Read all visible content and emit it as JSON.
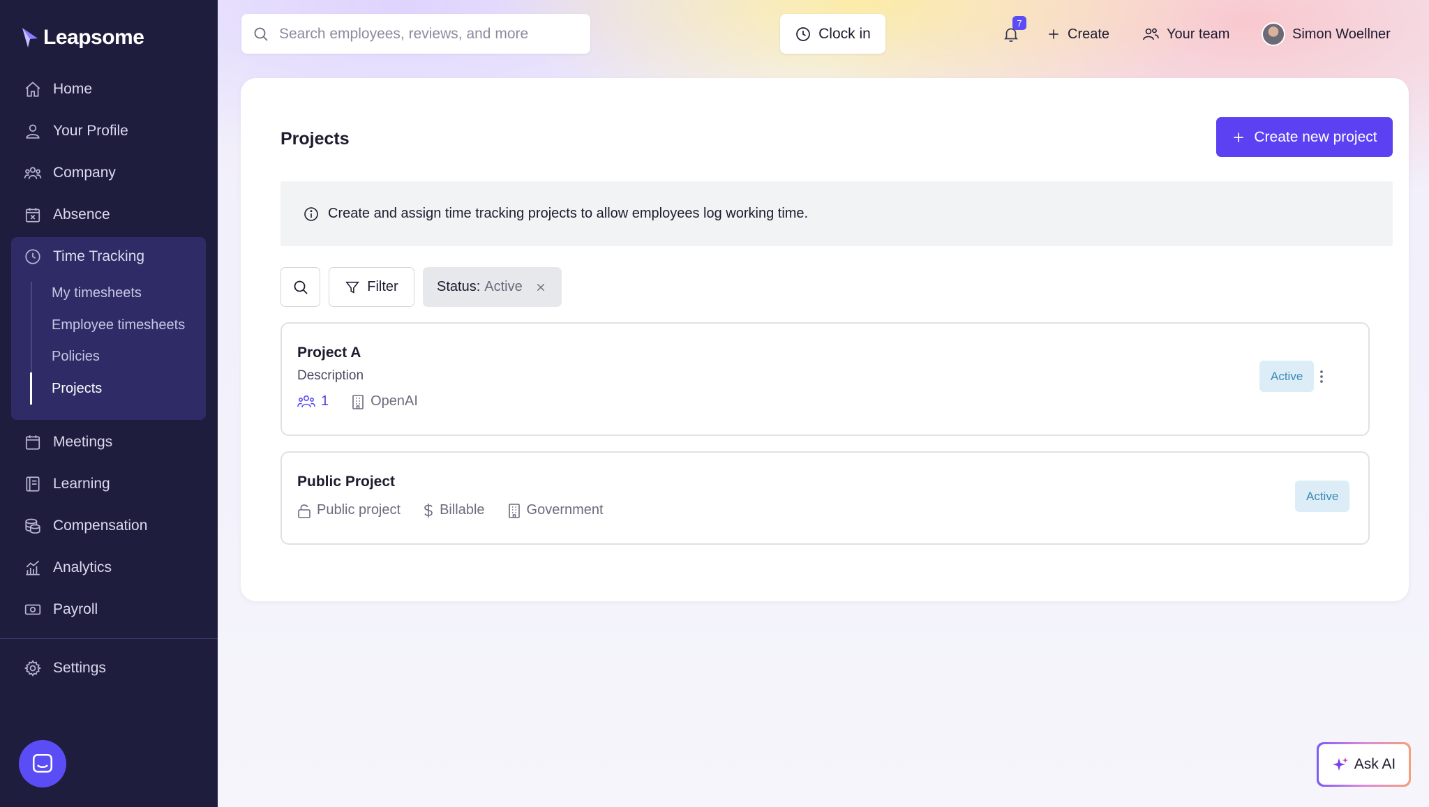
{
  "app": {
    "name": "Leapsome"
  },
  "sidebar": {
    "items": [
      {
        "label": "Home",
        "icon": "home-icon"
      },
      {
        "label": "Your Profile",
        "icon": "user-icon"
      },
      {
        "label": "Company",
        "icon": "company-icon"
      },
      {
        "label": "Absence",
        "icon": "calendar-x-icon"
      },
      {
        "label": "Time Tracking",
        "icon": "clock-icon"
      },
      {
        "label": "Meetings",
        "icon": "calendar-icon"
      },
      {
        "label": "Learning",
        "icon": "book-icon"
      },
      {
        "label": "Compensation",
        "icon": "coins-icon"
      },
      {
        "label": "Analytics",
        "icon": "analytics-icon"
      },
      {
        "label": "Payroll",
        "icon": "banknote-icon"
      }
    ],
    "time_tracking_sub": [
      {
        "label": "My timesheets"
      },
      {
        "label": "Employee timesheets"
      },
      {
        "label": "Policies"
      },
      {
        "label": "Projects",
        "active": true
      }
    ],
    "settings_label": "Settings"
  },
  "topbar": {
    "search_placeholder": "Search employees, reviews, and more",
    "clock_in_label": "Clock in",
    "notification_count": "7",
    "create_label": "Create",
    "your_team_label": "Your team",
    "user_name": "Simon Woellner"
  },
  "page": {
    "title": "Projects",
    "create_button_label": "Create new project",
    "info_text": "Create and assign time tracking projects to allow employees log working time.",
    "filter_label": "Filter",
    "status_filter_key": "Status:",
    "status_filter_value": "Active"
  },
  "projects": [
    {
      "name": "Project A",
      "description": "Description",
      "member_count": "1",
      "client": "OpenAI",
      "status": "Active"
    },
    {
      "name": "Public Project",
      "visibility": "Public project",
      "billing": "Billable",
      "client": "Government",
      "status": "Active"
    }
  ],
  "ask_ai_label": "Ask AI",
  "colors": {
    "sidebar_bg": "#1f1d3d",
    "sidebar_active_bg": "#2e2b66",
    "accent": "#5b41f2",
    "status_pill_bg": "#dcedf7",
    "status_pill_text": "#3b88b5"
  }
}
